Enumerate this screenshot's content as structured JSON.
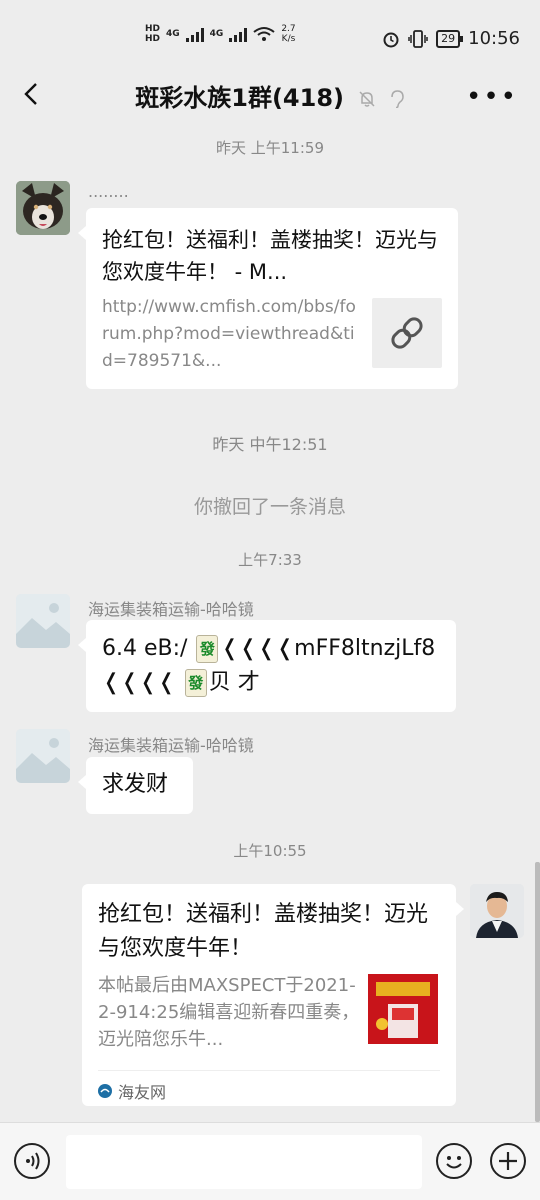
{
  "status_bar": {
    "net_speed": "2.7",
    "net_unit": "K/s",
    "battery": "29",
    "time": "10:56",
    "hd1": "HD",
    "hd2": "HD",
    "lte1": "4G",
    "lte2": "4G"
  },
  "header": {
    "title": "斑彩水族1群(418)",
    "more_label": "•••"
  },
  "messages": {
    "t1": "昨天 上午11:59",
    "m1": {
      "sender": "........",
      "title": "抢红包！送福利！盖楼抽奖！迈光与您欢度牛年！ - M...",
      "desc": "http://www.cmfish.com/bbs/forum.php?mod=viewthread&tid=789571&..."
    },
    "t2": "昨天 中午12:51",
    "recall": "你撤回了一条消息",
    "t3": "上午7:33",
    "m2": {
      "sender": "海运集装箱运输-哈哈镜",
      "line1_a": "6.4 eB:/ ",
      "line1_b": "❬❬❬❬mFF8ltnzjLf8",
      "line2_a": "❬❬❬❬ ",
      "line2_b": "贝 才",
      "tile": "發"
    },
    "m3": {
      "sender": "海运集装箱运输-哈哈镜",
      "text": "求发财"
    },
    "t4": "上午10:55",
    "m4": {
      "title": "抢红包！送福利！盖楼抽奖！迈光与您欢度牛年！",
      "desc": "本帖最后由MAXSPECT于2021-2-914:25编辑喜迎新春四重奏，迈光陪您乐牛...",
      "source": "海友网"
    }
  },
  "colors": {
    "background": "#ededed",
    "bubble": "#ffffff",
    "link_tile": "#ededed"
  }
}
